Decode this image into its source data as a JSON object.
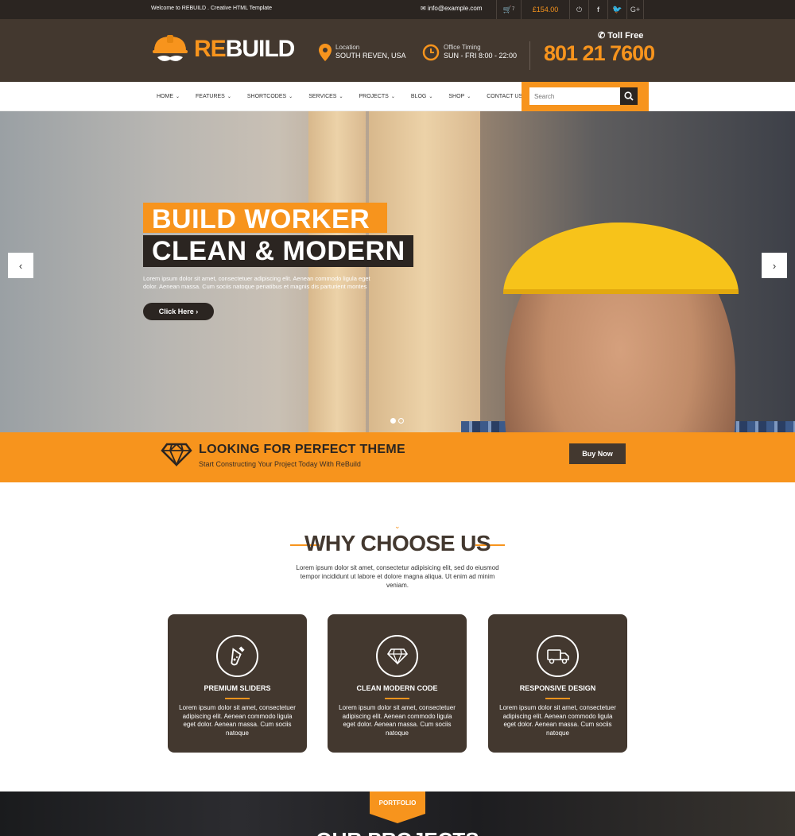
{
  "topbar": {
    "welcome": "Welcome to REBUILD . Creative HTML Template",
    "email": "info@example.com",
    "cart_count": "7",
    "price": "£154.00"
  },
  "header": {
    "logo_re": "RE",
    "logo_build": "BUILD",
    "location_label": "Location",
    "location_value": "SOUTH REVEN, USA",
    "timing_label": "Office Timing",
    "timing_value": "SUN - FRI 8:00 - 22:00",
    "toll_free": "Toll Free",
    "phone": "801 21 7600"
  },
  "nav": {
    "items": [
      {
        "label": "HOME"
      },
      {
        "label": "FEATURES"
      },
      {
        "label": "SHORTCODES"
      },
      {
        "label": "SERVICES"
      },
      {
        "label": "PROJECTS"
      },
      {
        "label": "BLOG"
      },
      {
        "label": "SHOP"
      },
      {
        "label": "CONTACT US"
      }
    ],
    "search_placeholder": "Search"
  },
  "hero": {
    "title1": "BUILD WORKER",
    "title2": "CLEAN & MODERN",
    "text": "Lorem ipsum dolor sit amet, consectetuer adipiscing elit. Aenean commodo ligula eget dolor. Aenean massa. Cum sociis natoque penatibus et magnis dis parturient montes",
    "button": "Click Here"
  },
  "cta": {
    "title": "LOOKING FOR PERFECT THEME",
    "subtitle": "Start Constructing Your Project Today With ReBuild",
    "button": "Buy Now"
  },
  "why": {
    "title": "WHY CHOOSE US",
    "text": "Lorem ipsum dolor sit amet, consectetur adipisicing elit, sed do eiusmod tempor incididunt ut labore et dolore magna aliqua. Ut enim ad minim veniam.",
    "cards": [
      {
        "title": "PREMIUM SLIDERS",
        "icon": "flask-icon",
        "text": "Lorem ipsum dolor sit amet, consectetuer adipiscing elit. Aenean commodo ligula eget dolor. Aenean massa. Cum sociis natoque"
      },
      {
        "title": "CLEAN MODERN CODE",
        "icon": "diamond-icon",
        "text": "Lorem ipsum dolor sit amet, consectetuer adipiscing elit. Aenean commodo ligula eget dolor. Aenean massa. Cum sociis natoque"
      },
      {
        "title": "RESPONSIVE DESIGN",
        "icon": "truck-icon",
        "text": "Lorem ipsum dolor sit amet, consectetuer adipiscing elit. Aenean commodo ligula eget dolor. Aenean massa. Cum sociis natoque"
      }
    ]
  },
  "portfolio": {
    "tag": "PORTFOLIO",
    "title": "OUR PROJECTS"
  },
  "colors": {
    "accent": "#f7941d",
    "dark": "#43382f",
    "darker": "#2b2521"
  }
}
